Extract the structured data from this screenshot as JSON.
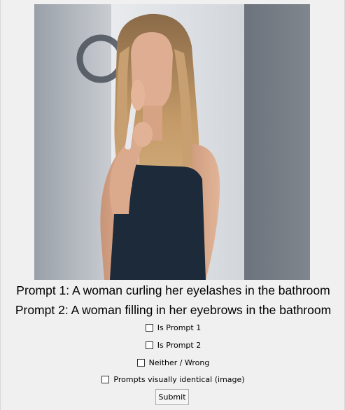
{
  "photo": {
    "subject": "woman-with-tool-at-face"
  },
  "prompts": {
    "prompt1": "Prompt 1: A woman curling her eyelashes in the bathroom",
    "prompt2": "Prompt 2: A woman filling in her eyebrows in the bathroom"
  },
  "options": [
    {
      "label": "Is Prompt 1",
      "checked": false
    },
    {
      "label": "Is Prompt 2",
      "checked": false
    },
    {
      "label": "Neither / Wrong",
      "checked": false
    },
    {
      "label": "Prompts visually identical (image)",
      "checked": false
    }
  ],
  "submit_label": "Submit",
  "colors": {
    "background": "#f0f0f0",
    "tank_top": "#1d2a3a",
    "hair": "#b48a5c",
    "skin": "#d9a98a"
  }
}
